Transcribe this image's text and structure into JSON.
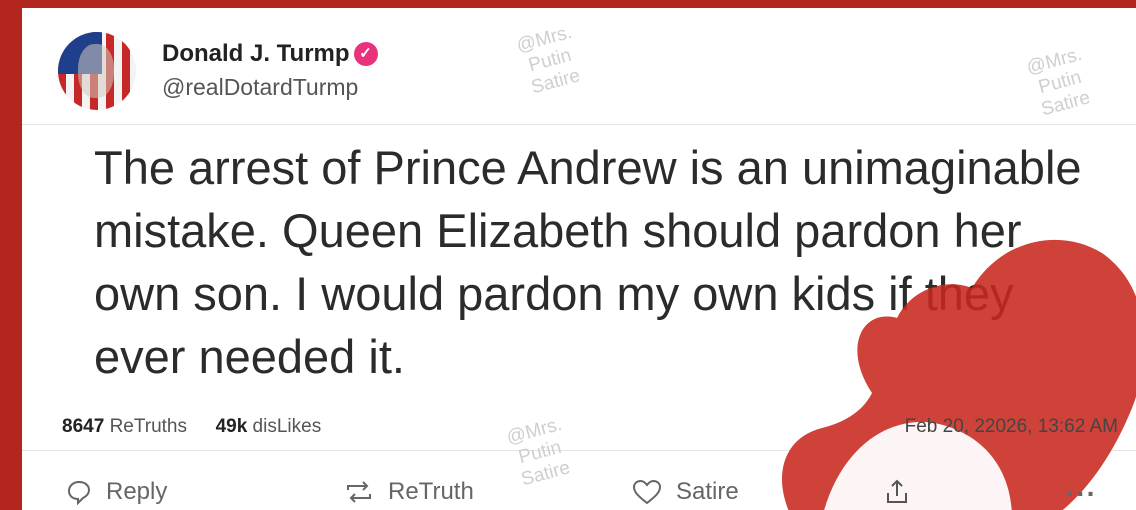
{
  "account": {
    "name": "Donald J. Turmp",
    "handle": "@realDotardTurmp",
    "verified_color": "#e8327c"
  },
  "tweet": {
    "text": "The arrest of Prince Andrew is an unimaginable mistake. Queen Elizabeth should pardon her own son. I would pardon my own kids if they ever needed it.",
    "timestamp": "Feb 20, 22026, 13:62 AM"
  },
  "stats": {
    "retruths_count": "8647",
    "retruths_label": "ReTruths",
    "dislikes_count": "49k",
    "dislikes_label": "disLikes"
  },
  "actions": {
    "reply_label": "Reply",
    "retruth_label": "ReTruth",
    "like_label": "Satire"
  },
  "watermark": {
    "line1": "@Mrs.",
    "line2": "Putin",
    "line3": "Satire"
  },
  "colors": {
    "frame": "#b3261d",
    "overlay_heart": "#c8281e"
  }
}
